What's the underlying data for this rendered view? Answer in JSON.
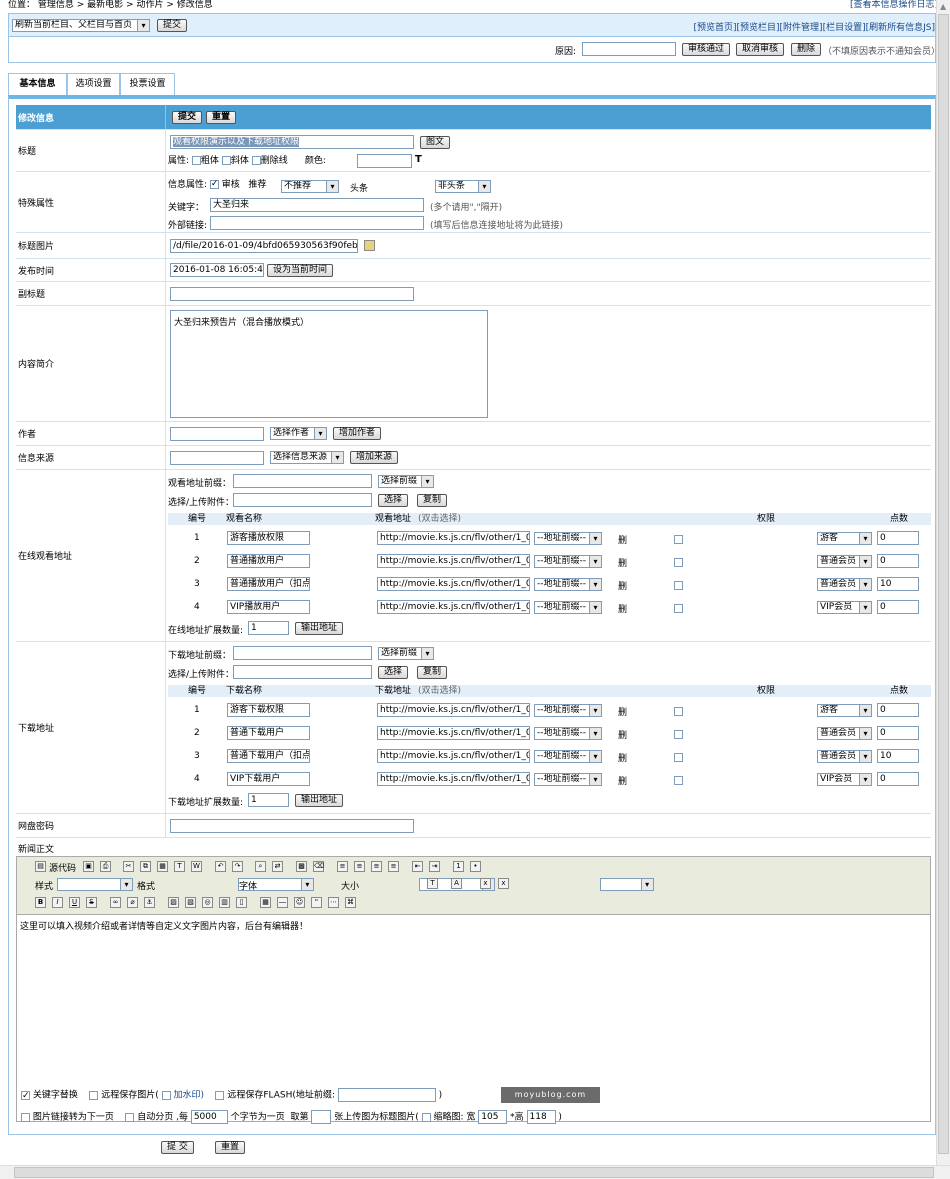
{
  "breadcrumb": {
    "prefix": "位置：",
    "items": [
      "管理信息",
      "最新电影",
      "动作片",
      "修改信息"
    ],
    "sep": " > "
  },
  "top_right_link": "[查看本信息操作日志]",
  "refresh": {
    "select": "刷新当前栏目、父栏目与首页",
    "submit": "提交"
  },
  "toplinks": [
    "[预览首页]",
    "[预览栏目]",
    "[附件管理]",
    "[栏目设置]",
    "[刷新所有信息JS]"
  ],
  "review": {
    "reason_label": "原因:",
    "pass": "审核通过",
    "cancel": "取消审核",
    "delete": "删除",
    "note": "（不填原因表示不通知会员）"
  },
  "tabs": [
    "基本信息",
    "选项设置",
    "投票设置"
  ],
  "form": {
    "header": {
      "label": "修改信息",
      "submit": "提交",
      "reset": "重置"
    },
    "title": {
      "label": "标题",
      "value": "观看权限演示以及下载地址权限",
      "btn": "图文",
      "attr": "属性:",
      "bold": "粗体",
      "italic": "斜体",
      "strike": "删除线",
      "color": "颜色:"
    },
    "special": {
      "label": "特殊属性",
      "info_attr": "信息属性:",
      "audit": "审核",
      "recommend": "推荐",
      "recommend_val": "不推荐",
      "headline": "头条",
      "headline_val": "非头条",
      "kw_label": "关键字：",
      "kw_val": "大圣归来",
      "kw_hint": "(多个请用\",\"隔开)",
      "ext_label": "外部链接:",
      "ext_hint": "(填写后信息连接地址将为此链接)"
    },
    "titlepic": {
      "label": "标题图片",
      "value": "/d/file/2016-01-09/4bfd065930563f90feb77"
    },
    "pubtime": {
      "label": "发布时间",
      "value": "2016-01-08 16:05:47",
      "btn": "设为当前时间"
    },
    "subtitle": {
      "label": "副标题"
    },
    "intro": {
      "label": "内容简介",
      "value": "大圣归来预告片（混合播放模式）"
    },
    "author": {
      "label": "作者",
      "select": "选择作者",
      "btn": "增加作者"
    },
    "source": {
      "label": "信息来源",
      "select": "选择信息来源",
      "btn": "增加来源"
    },
    "online": {
      "label": "在线观看地址",
      "prefix_label": "观看地址前缀：",
      "prefix_sel": "选择前缀",
      "upload_label": "选择/上传附件：",
      "choose": "选择",
      "copy": "复制",
      "cols": [
        "编号",
        "观看名称",
        "观看地址",
        "(双击选择)",
        "权限",
        "点数"
      ],
      "rows": [
        {
          "n": "1",
          "name": "游客播放权限",
          "url": "http://movie.ks.js.cn/flv/other/1_0.m",
          "pre": "--地址前缀--",
          "del": "删",
          "perm": "游客",
          "pts": "0"
        },
        {
          "n": "2",
          "name": "普通播放用户",
          "url": "http://movie.ks.js.cn/flv/other/1_0.m",
          "pre": "--地址前缀--",
          "del": "删",
          "perm": "普通会员",
          "pts": "0"
        },
        {
          "n": "3",
          "name": "普通播放用户（扣点",
          "url": "http://movie.ks.js.cn/flv/other/1_0.m",
          "pre": "--地址前缀--",
          "del": "删",
          "perm": "普通会员",
          "pts": "10"
        },
        {
          "n": "4",
          "name": "VIP播放用户",
          "url": "http://movie.ks.js.cn/flv/other/1_0.m",
          "pre": "--地址前缀--",
          "del": "删",
          "perm": "VIP会员",
          "pts": "0"
        }
      ],
      "ext_label": "在线地址扩展数量:",
      "ext_val": "1",
      "ext_btn": "输出地址"
    },
    "download": {
      "label": "下载地址",
      "prefix_label": "下载地址前缀：",
      "prefix_sel": "选择前缀",
      "upload_label": "选择/上传附件：",
      "choose": "选择",
      "copy": "复制",
      "cols": [
        "编号",
        "下载名称",
        "下载地址",
        "(双击选择)",
        "权限",
        "点数"
      ],
      "rows": [
        {
          "n": "1",
          "name": "游客下载权限",
          "url": "http://movie.ks.js.cn/flv/other/1_0.m",
          "pre": "--地址前缀--",
          "del": "删",
          "perm": "游客",
          "pts": "0"
        },
        {
          "n": "2",
          "name": "普通下载用户",
          "url": "http://movie.ks.js.cn/flv/other/1_0.m",
          "pre": "--地址前缀--",
          "del": "删",
          "perm": "普通会员",
          "pts": "0"
        },
        {
          "n": "3",
          "name": "普通下载用户（扣点",
          "url": "http://movie.ks.js.cn/flv/other/1_0.m",
          "pre": "--地址前缀--",
          "del": "删",
          "perm": "普通会员",
          "pts": "10"
        },
        {
          "n": "4",
          "name": "VIP下载用户",
          "url": "http://movie.ks.js.cn/flv/other/1_0.m",
          "pre": "--地址前缀--",
          "del": "删",
          "perm": "VIP会员",
          "pts": "0"
        }
      ],
      "ext_label": "下载地址扩展数量:",
      "ext_val": "1",
      "ext_btn": "输出地址"
    },
    "panpwd": {
      "label": "网盘密码"
    },
    "body": {
      "label": "新闻正文",
      "source_btn": "源代码",
      "style": "样式",
      "format": "格式",
      "font": "字体",
      "size": "大小",
      "content": "这里可以填入视频介绍或者详情等自定义文字图片内容，后台有编辑器！"
    },
    "opts": {
      "kw_replace": "关键字替换",
      "save_img": "远程保存图片(",
      "watermark": "加水印)",
      "save_flash": "远程保存FLASH(地址前缀:",
      "close": ")",
      "img_link": "图片链接转为下一页",
      "autopage": "自动分页 ,每",
      "autopage_val": "5000",
      "autopage_unit": "个字节为一页",
      "take": "取第",
      "upload_title": "张上传图为标题图片(",
      "thumb": "缩略图: 宽",
      "w_val": "105",
      "h_label": "*高",
      "h_val": "118",
      "end": ")"
    },
    "footer": {
      "submit": "提 交",
      "reset": "重置"
    }
  },
  "watermark": "moyublog.com"
}
